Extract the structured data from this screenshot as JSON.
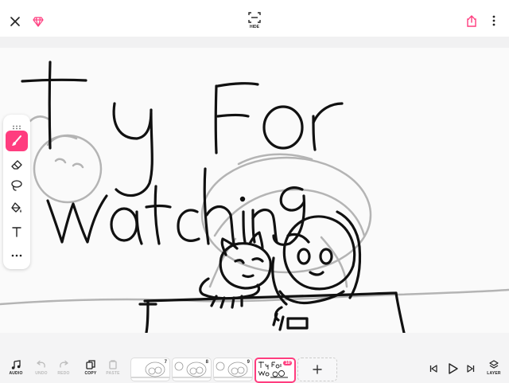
{
  "header": {
    "hide_label": "HIDE",
    "icons": [
      "close-icon",
      "gem-icon",
      "hide-ui-icon",
      "share-icon",
      "more-vertical-icon"
    ]
  },
  "tools": {
    "items": [
      "drag-handle-icon",
      "brush-icon",
      "eraser-icon",
      "lasso-icon",
      "fill-bucket-icon",
      "text-icon",
      "more-icon"
    ],
    "active": "brush-icon"
  },
  "bottom": {
    "audio_label": "AUDIO",
    "undo_label": "UNDO",
    "redo_label": "REDO",
    "copy_label": "COPY",
    "paste_label": "PASTE",
    "layer_label": "LAYER",
    "frames": [
      {
        "number": "7"
      },
      {
        "number": "8"
      },
      {
        "number": "9"
      },
      {
        "number": "10",
        "active": true
      }
    ]
  },
  "colors": {
    "accent": "#ff3d7f",
    "ink": "#111111",
    "onion_skin": "#b4b4b4"
  }
}
